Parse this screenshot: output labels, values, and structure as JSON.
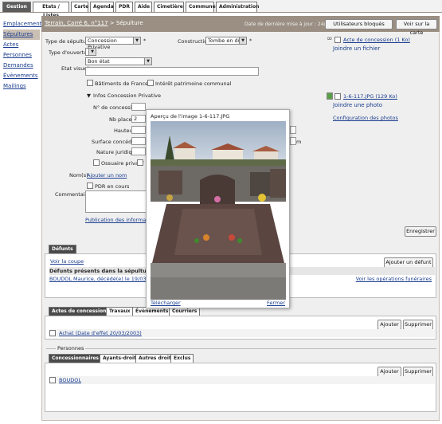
{
  "topnav": {
    "tabs": [
      {
        "label": "Gestion",
        "active": true
      },
      {
        "label": "Etats / Listes"
      },
      {
        "label": "Carte"
      },
      {
        "label": "Agenda"
      },
      {
        "label": "PDR"
      },
      {
        "label": "Aide"
      },
      {
        "label": "Cimetière"
      },
      {
        "label": "Commune"
      },
      {
        "label": "Administration"
      }
    ]
  },
  "sidebar": {
    "items": [
      {
        "label": "Emplacements"
      },
      {
        "label": "Sépultures",
        "active": true
      },
      {
        "label": "Actes"
      },
      {
        "label": "Personnes"
      },
      {
        "label": "Demandes"
      },
      {
        "label": "Évènements"
      },
      {
        "label": "Mailings"
      }
    ]
  },
  "header": {
    "crumb_link": "Terrain, Carré 6, n°117",
    "crumb_tail": "> Sépulture",
    "date": "Date de dernière mise à jour : 24/08/2015 11:00",
    "btn_users": "Utilisateurs bloqués",
    "btn_map": "Voir sur la carte"
  },
  "form": {
    "type_sepulture_label": "Type de sépulture",
    "type_sepulture_value": "Concession Privative",
    "construction_label": "Construction",
    "construction_value": "Tombe en dur",
    "type_ouverture_label": "Type d'ouverture",
    "etat_visuel_label": "Etat visuel",
    "etat_visuel_value": "Bon état",
    "batiments_label": "Bâtiments de France",
    "interet_label": "Intérêt patrimoine communal",
    "infos_label": "Infos Concession Privative",
    "no_concession_label": "N° de concession",
    "nb_places_label": "Nb places",
    "nb_places_value": "2",
    "hauteur_label": "Hauteur",
    "surface_label": "Surface concédée",
    "surface_unit": "m",
    "nature_label": "Nature juridique",
    "ossuaire_label": "Ossuaire privatif",
    "noms_label": "Nom(s)",
    "ajouter_nom": "Ajouter un nom",
    "pdr_label": "PDR en cours",
    "commentaire_label": "Commentaire",
    "publication_link": "Publication des informations",
    "enregistrer": "Enregistrer"
  },
  "attachments": {
    "acte_link": "Acte de concession (1 Ko)",
    "joindre_fichier": "Joindre un fichier",
    "photo_link": "1-6-117.JPG (129 Ko)",
    "joindre_photo": "Joindre une photo",
    "config_photos": "Configuration des photos"
  },
  "popup": {
    "title": "Aperçu de l'image 1-6-117.JPG",
    "download": "Télécharger",
    "close": "Fermer"
  },
  "defunts": {
    "tab": "Défunts",
    "voir_coupe": "Voir la coupe",
    "ajouter_defunt": "Ajouter un défunt",
    "presents": "Défunts présents dans la sépulture",
    "row": "BOUDOL Maurice, décédé(e) le 19/03/2003",
    "voir_ops": "Voir les opérations funéraires"
  },
  "actes": {
    "tabs": [
      "Actes de concession",
      "Travaux",
      "Évènements",
      "Courriers"
    ],
    "ajouter": "Ajouter",
    "supprimer": "Supprimer",
    "row": "Achat (Date d'effet 20/03/2003)"
  },
  "personnes": {
    "legend": "Personnes",
    "tabs": [
      "Concessionnaires",
      "Ayants-droit",
      "Autres droit",
      "Exclus"
    ],
    "ajouter": "Ajouter",
    "supprimer": "Supprimer",
    "row": "BOUDOL"
  }
}
